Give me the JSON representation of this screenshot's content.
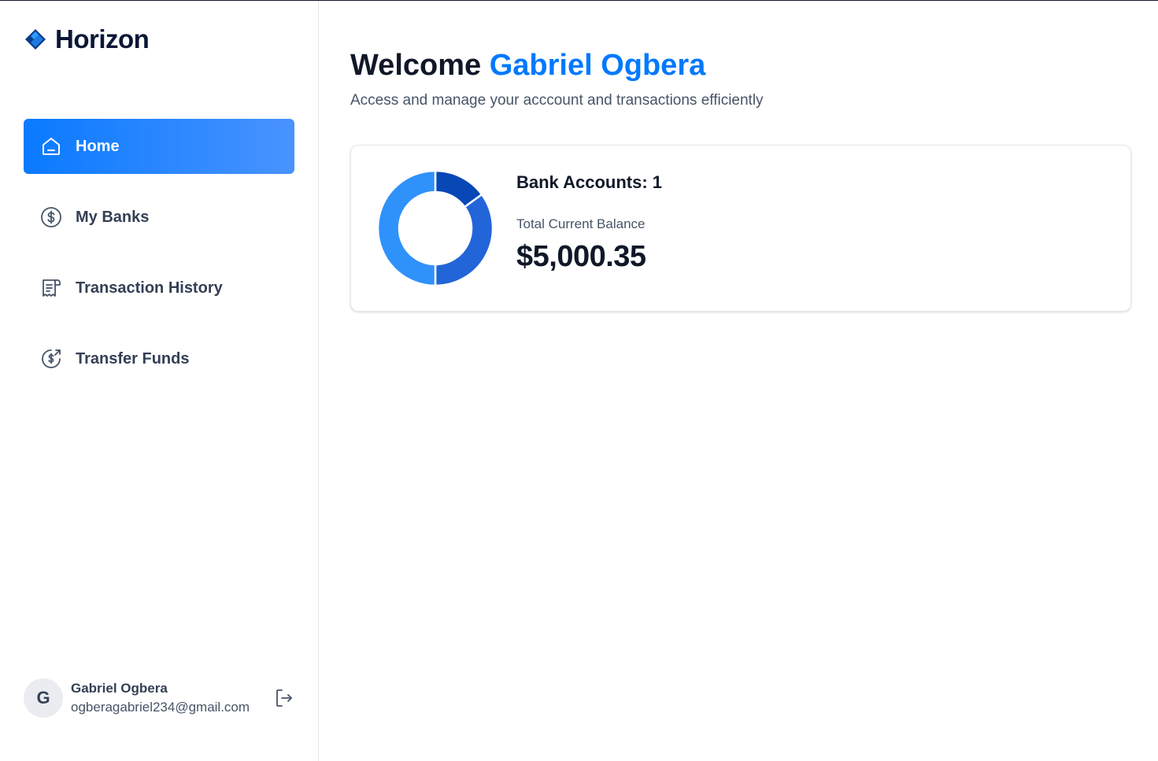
{
  "app": {
    "name": "Horizon"
  },
  "sidebar": {
    "items": [
      {
        "label": "Home",
        "icon": "home-icon",
        "active": true
      },
      {
        "label": "My Banks",
        "icon": "dollar-circle-icon",
        "active": false
      },
      {
        "label": "Transaction History",
        "icon": "receipt-icon",
        "active": false
      },
      {
        "label": "Transfer Funds",
        "icon": "money-send-icon",
        "active": false
      }
    ]
  },
  "user": {
    "initial": "G",
    "name": "Gabriel Ogbera",
    "email": "ogberagabriel234@gmail.com"
  },
  "header": {
    "welcome": "Welcome",
    "name": "Gabriel Ogbera",
    "subtext": "Access and manage your acccount and transactions efficiently"
  },
  "balance_card": {
    "bank_accounts_label": "Bank Accounts: 1",
    "total_label": "Total Current Balance",
    "total_value": "$5,000.35"
  },
  "chart_data": {
    "type": "pie",
    "values": [
      15,
      35,
      50
    ],
    "colors": [
      "#0747b6",
      "#2265d8",
      "#2f91fa"
    ]
  },
  "colors": {
    "accent": "#0179fe",
    "active_gradient_start": "#0a7aff",
    "active_gradient_end": "#4893ff"
  }
}
